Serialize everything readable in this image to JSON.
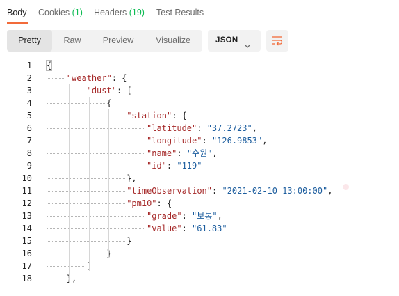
{
  "tabs": {
    "body": "Body",
    "cookies": "Cookies",
    "cookies_count": "(1)",
    "headers": "Headers",
    "headers_count": "(19)",
    "test_results": "Test Results"
  },
  "view_modes": [
    "Pretty",
    "Raw",
    "Preview",
    "Visualize"
  ],
  "format_select": {
    "value": "JSON",
    "icon": "chevron-down-icon"
  },
  "wrap_button": {
    "icon": "wrap-lines-icon",
    "color": "#f26b3a"
  },
  "colors": {
    "accent": "#f26b3a",
    "count": "#0cbb52",
    "key": "#a62a2a",
    "string": "#1c5d9e"
  },
  "editor": {
    "lines": [
      {
        "n": "1",
        "indent": 0,
        "parts": [
          [
            "p",
            "{"
          ]
        ]
      },
      {
        "n": "2",
        "indent": 1,
        "parts": [
          [
            "k",
            "\"weather\""
          ],
          [
            "p",
            ": {"
          ]
        ]
      },
      {
        "n": "3",
        "indent": 2,
        "parts": [
          [
            "k",
            "\"dust\""
          ],
          [
            "p",
            ": ["
          ]
        ]
      },
      {
        "n": "4",
        "indent": 3,
        "parts": [
          [
            "p",
            "{"
          ]
        ]
      },
      {
        "n": "5",
        "indent": 4,
        "parts": [
          [
            "k",
            "\"station\""
          ],
          [
            "p",
            ": {"
          ]
        ]
      },
      {
        "n": "6",
        "indent": 5,
        "parts": [
          [
            "k",
            "\"latitude\""
          ],
          [
            "p",
            ": "
          ],
          [
            "s",
            "\"37.2723\""
          ],
          [
            "p",
            ","
          ]
        ]
      },
      {
        "n": "7",
        "indent": 5,
        "parts": [
          [
            "k",
            "\"longitude\""
          ],
          [
            "p",
            ": "
          ],
          [
            "s",
            "\"126.9853\""
          ],
          [
            "p",
            ","
          ]
        ]
      },
      {
        "n": "8",
        "indent": 5,
        "parts": [
          [
            "k",
            "\"name\""
          ],
          [
            "p",
            ": "
          ],
          [
            "s",
            "\"수원\""
          ],
          [
            "p",
            ","
          ]
        ]
      },
      {
        "n": "9",
        "indent": 5,
        "parts": [
          [
            "k",
            "\"id\""
          ],
          [
            "p",
            ": "
          ],
          [
            "s",
            "\"119\""
          ]
        ]
      },
      {
        "n": "10",
        "indent": 4,
        "parts": [
          [
            "p",
            "},"
          ]
        ]
      },
      {
        "n": "11",
        "indent": 4,
        "parts": [
          [
            "k",
            "\"timeObservation\""
          ],
          [
            "p",
            ": "
          ],
          [
            "s",
            "\"2021-02-10 13:00:00\""
          ],
          [
            "p",
            ","
          ]
        ]
      },
      {
        "n": "12",
        "indent": 4,
        "parts": [
          [
            "k",
            "\"pm10\""
          ],
          [
            "p",
            ": {"
          ]
        ]
      },
      {
        "n": "13",
        "indent": 5,
        "parts": [
          [
            "k",
            "\"grade\""
          ],
          [
            "p",
            ": "
          ],
          [
            "s",
            "\"보통\""
          ],
          [
            "p",
            ","
          ]
        ]
      },
      {
        "n": "14",
        "indent": 5,
        "parts": [
          [
            "k",
            "\"value\""
          ],
          [
            "p",
            ": "
          ],
          [
            "s",
            "\"61.83\""
          ]
        ]
      },
      {
        "n": "15",
        "indent": 4,
        "parts": [
          [
            "p",
            "}"
          ]
        ]
      },
      {
        "n": "16",
        "indent": 3,
        "parts": [
          [
            "p",
            "}"
          ]
        ]
      },
      {
        "n": "17",
        "indent": 2,
        "parts": [
          [
            "p",
            "]"
          ]
        ]
      },
      {
        "n": "18",
        "indent": 1,
        "parts": [
          [
            "p",
            "},"
          ]
        ]
      }
    ]
  }
}
